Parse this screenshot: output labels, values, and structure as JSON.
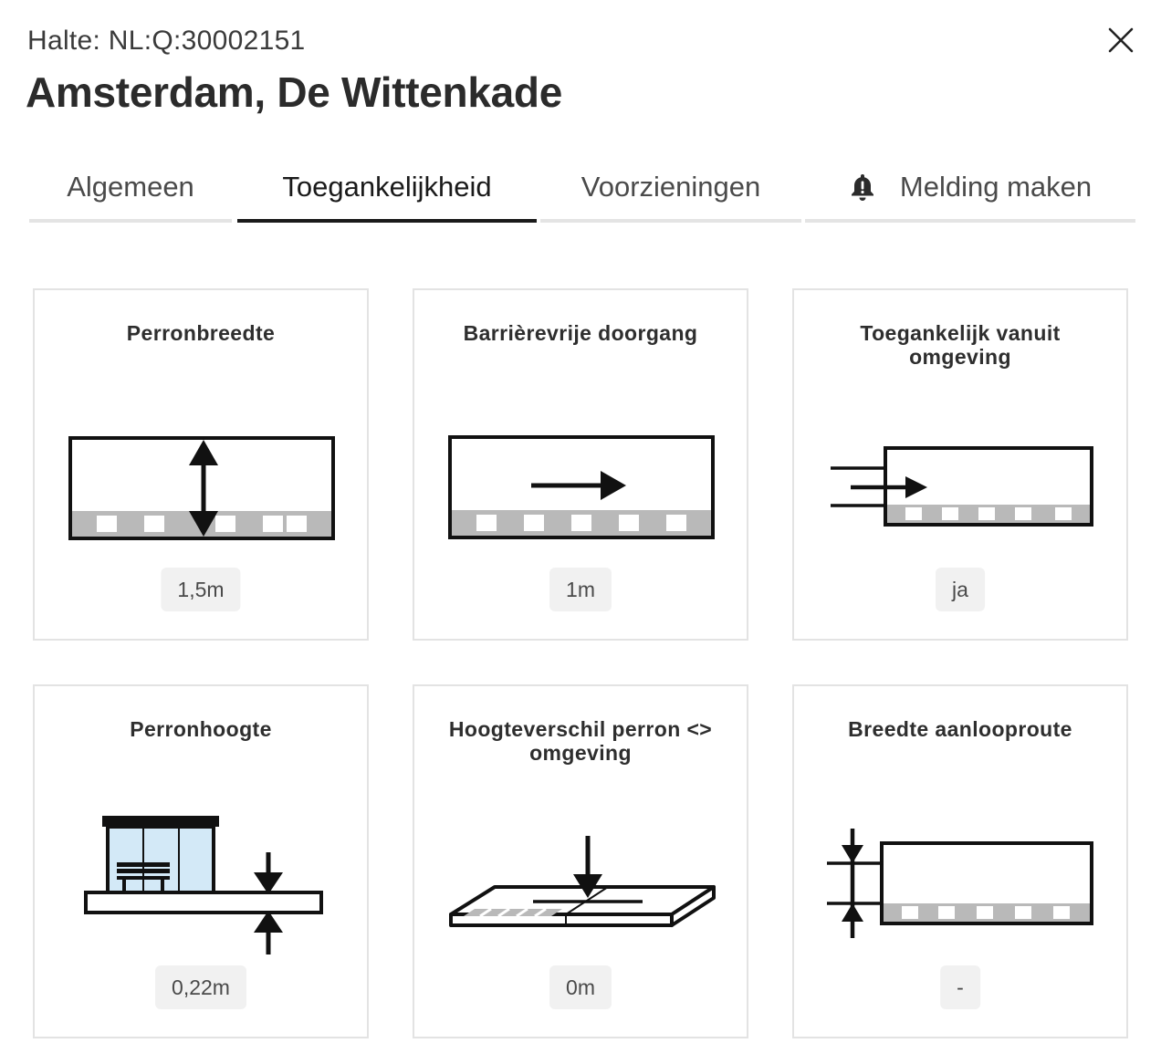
{
  "header": {
    "subtitle": "Halte: NL:Q:30002151",
    "title": "Amsterdam, De Wittenkade"
  },
  "tabs": [
    {
      "label": "Algemeen",
      "active": false
    },
    {
      "label": "Toegankelijkheid",
      "active": true
    },
    {
      "label": "Voorzieningen",
      "active": false
    },
    {
      "label": "Melding maken",
      "active": false,
      "icon": "bell-icon"
    }
  ],
  "cards": [
    {
      "title": "Perronbreedte",
      "value": "1,5m",
      "icon": "platform-width-icon"
    },
    {
      "title": "Barrièrevrije doorgang",
      "value": "1m",
      "icon": "barrier-free-passage-icon"
    },
    {
      "title": "Toegankelijk vanuit omgeving",
      "value": "ja",
      "icon": "accessible-from-surroundings-icon"
    },
    {
      "title": "Perronhoogte",
      "value": "0,22m",
      "icon": "platform-height-icon"
    },
    {
      "title": "Hoogteverschil perron <> omgeving",
      "value": "0m",
      "icon": "height-difference-icon"
    },
    {
      "title": "Breedte aanlooproute",
      "value": "-",
      "icon": "approach-route-width-icon"
    }
  ],
  "colors": {
    "active_tab": "#1a1a1a",
    "inactive_tab_line": "#e4e4e4",
    "card_border": "#e3e3e3",
    "value_badge": "#f1f1f1",
    "tactile_strip": "#b9b9b9",
    "shelter_glass": "#d3e9f7"
  }
}
